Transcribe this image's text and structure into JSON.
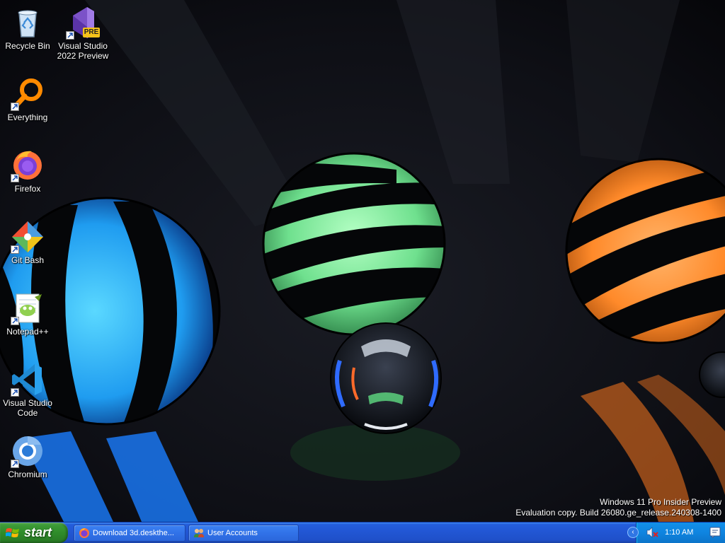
{
  "desktop": {
    "icons": [
      {
        "label": "Recycle Bin",
        "icon": "recycle-bin-icon"
      },
      {
        "label": "Visual Studio\n2022 Preview",
        "icon": "visual-studio-preview-icon",
        "badge": "PRE"
      },
      {
        "label": "Everything",
        "icon": "everything-search-icon"
      },
      {
        "label": "Firefox",
        "icon": "firefox-icon"
      },
      {
        "label": "Git Bash",
        "icon": "git-bash-icon"
      },
      {
        "label": "Notepad++",
        "icon": "notepad-plus-plus-icon"
      },
      {
        "label": "Visual Studio\nCode",
        "icon": "vscode-icon"
      },
      {
        "label": "Chromium",
        "icon": "chromium-icon"
      }
    ],
    "watermark": {
      "line1": "Windows 11 Pro Insider Preview",
      "line2": "Evaluation copy. Build 26080.ge_release.240308-1400"
    }
  },
  "taskbar": {
    "start_label": "start",
    "tasks": [
      {
        "label": "Download 3d.deskthe...",
        "icon": "firefox-icon"
      },
      {
        "label": "User Accounts",
        "icon": "user-accounts-icon"
      }
    ],
    "tray": {
      "time": "1:10 AM",
      "icons": [
        "chevron-left-icon",
        "volume-muted-icon",
        "notification-icon"
      ]
    }
  },
  "colors": {
    "taskbar_blue": "#245edb",
    "start_green": "#3c9a36",
    "tray_blue": "#0f84e0"
  }
}
